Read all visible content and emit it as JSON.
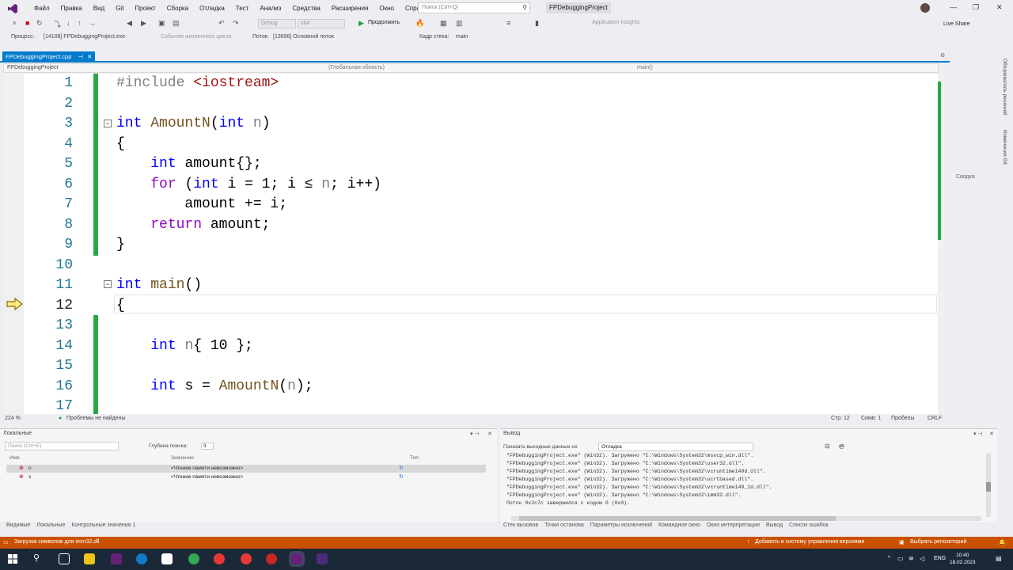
{
  "menu": {
    "items": [
      "Файл",
      "Правка",
      "Вид",
      "Git",
      "Проект",
      "Сборка",
      "Отладка",
      "Тест",
      "Анализ",
      "Средства",
      "Расширения",
      "Окно",
      "Справка"
    ],
    "search_placeholder": "Поиск (Ctrl+Q)",
    "project_name": "FPDebuggingProject"
  },
  "toolbar": {
    "config": "Debug",
    "platform": "x64",
    "continue_label": "Продолжить",
    "app_insights": "Application Insights",
    "live_share": "Live Share"
  },
  "locbar": {
    "process_label": "Процесс:",
    "process_value": "[14108] FPDebuggingProject.exe",
    "lifecycle": "События жизненного цикла",
    "thread_label": "Поток:",
    "thread_value": "[13696] Основной поток",
    "stack_label": "Кадр стека:",
    "stack_value": "main"
  },
  "document": {
    "tab": "FPDebuggingProject.cpp",
    "nav_project": "FPDebuggingProject",
    "nav_scope": "(Глобальная область)",
    "nav_func": "main()"
  },
  "code": {
    "lines": [
      "1",
      "2",
      "3",
      "4",
      "5",
      "6",
      "7",
      "8",
      "9",
      "10",
      "11",
      "12",
      "13",
      "14",
      "15",
      "16",
      "17"
    ],
    "current_line": "12"
  },
  "editor_status": {
    "zoom": "224 %",
    "problems": "Проблемы не найдены",
    "line": "Стр: 12",
    "col": "Симв: 1",
    "spaces": "Пробелы",
    "eol": "CRLF"
  },
  "locals": {
    "title": "Локальные",
    "search_placeholder": "Поиск (Ctrl+E)",
    "depth_label": "Глубина поиска:",
    "depth_value": "3",
    "col_name": "Имя",
    "col_value": "Значение",
    "col_type": "Тип",
    "rows": [
      {
        "name": "n",
        "value": "<Чтение памяти невозможно>"
      },
      {
        "name": "s",
        "value": "<Чтение памяти невозможно>"
      }
    ],
    "tabs": [
      "Видимые",
      "Локальные",
      "Контрольные значения 1"
    ]
  },
  "output": {
    "title": "Вывод",
    "source_label": "Показать выходные данные из:",
    "source_value": "Отладка",
    "lines": [
      "\"FPDebuggingProject.exe\" (Win32). Загружено \"C:\\Windows\\System32\\msvcp_win.dll\".",
      "\"FPDebuggingProject.exe\" (Win32). Загружено \"C:\\Windows\\System32\\user32.dll\".",
      "\"FPDebuggingProject.exe\" (Win32). Загружено \"C:\\Windows\\System32\\vcruntime140d.dll\".",
      "\"FPDebuggingProject.exe\" (Win32). Загружено \"C:\\Windows\\System32\\ucrtbased.dll\".",
      "\"FPDebuggingProject.exe\" (Win32). Загружено \"C:\\Windows\\System32\\vcruntime140_1d.dll\".",
      "\"FPDebuggingProject.exe\" (Win32). Загружено \"C:\\Windows\\System32\\imm32.dll\".",
      "Поток 0x2c7c завершился с кодом 0 (0x0)."
    ],
    "tabs": [
      "Стек вызовов",
      "Точки останова",
      "Параметры исключений",
      "Командное окно",
      "Окно интерпретации",
      "Вывод",
      "Список ошибок"
    ]
  },
  "statusbar": {
    "left": "Загрузка символов для imm32.dll",
    "vcs": "Добавить в систему управления версиями",
    "repo": "Выбрать репозиторий"
  },
  "rightrail": {
    "solution": "Обозреватель решений",
    "git": "Изменения Git",
    "summary": "Сводка"
  },
  "taskbar": {
    "lang": "ENG",
    "time": "10:40",
    "date": "18.02.2023"
  },
  "colors": {
    "accent": "#007acc",
    "status_orange": "#ca5100",
    "change_green": "#28a745"
  }
}
